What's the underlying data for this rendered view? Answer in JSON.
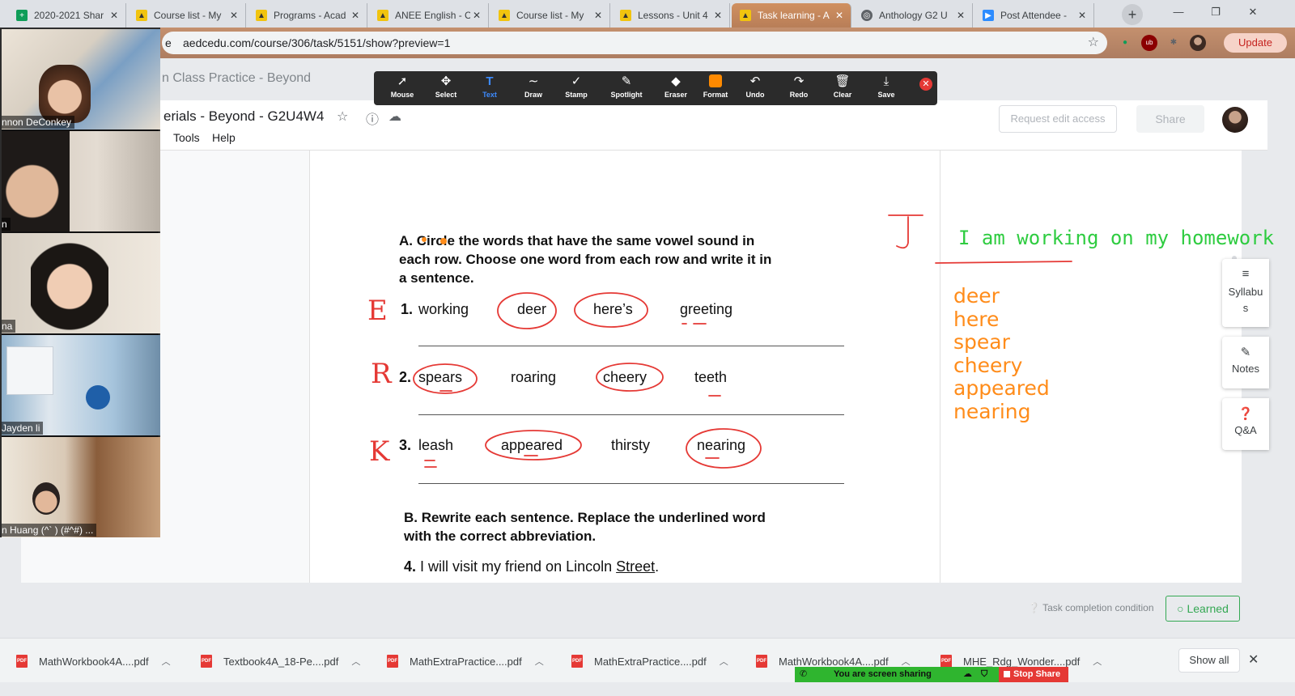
{
  "tabs": [
    {
      "title": "2020-2021 Shar",
      "icon": "sheets-icon",
      "color": "#0f9d58"
    },
    {
      "title": "Course list - My",
      "icon": "course-icon",
      "color": "#f1c40f"
    },
    {
      "title": "Programs - Acad",
      "icon": "course-icon",
      "color": "#f1c40f"
    },
    {
      "title": "ANEE English - C",
      "icon": "course-icon",
      "color": "#f1c40f"
    },
    {
      "title": "Course list - My",
      "icon": "course-icon",
      "color": "#f1c40f"
    },
    {
      "title": "Lessons - Unit 4",
      "icon": "course-icon",
      "color": "#f1c40f"
    },
    {
      "title": "Task learning - A",
      "icon": "course-icon",
      "color": "#f1c40f",
      "active": true
    },
    {
      "title": "Anthology G2 U",
      "icon": "globe-icon",
      "color": "#5f6368"
    },
    {
      "title": "Post Attendee -",
      "icon": "zoom-icon",
      "color": "#2d8cff"
    }
  ],
  "address": {
    "url": "aedcedu.com/course/306/task/5151/show?preview=1",
    "prefix": "e",
    "update_label": "Update"
  },
  "page": {
    "title": "n Class Practice - Beyond"
  },
  "doc": {
    "name": "erials - Beyond - G2U4W4",
    "menu": [
      "Tools",
      "Help"
    ],
    "request_label": "Request edit access",
    "share_label": "Share"
  },
  "worksheet": {
    "section_a": [
      "A. Circle the words that have the same vowel sound in",
      "each row. Choose one word from each row and write it in",
      "a sentence."
    ],
    "rows": [
      {
        "num": "1.",
        "words": [
          "working",
          "deer",
          "here’s",
          "greeting"
        ]
      },
      {
        "num": "2.",
        "words": [
          "spears",
          "roaring",
          "cheery",
          "teeth"
        ]
      },
      {
        "num": "3.",
        "words": [
          "leash",
          "appeared",
          "thirsty",
          "nearing"
        ]
      }
    ],
    "section_b": [
      "B. Rewrite each sentence. Replace the underlined word",
      "with the correct abbreviation."
    ],
    "sentence4": {
      "num": "4.",
      "before": "I will visit my friend on Lincoln ",
      "underlined": "Street",
      "after": "."
    }
  },
  "annotations": {
    "row_letters": [
      "E",
      "R",
      "K"
    ],
    "green_text": "I am working on my homework",
    "orange_words": [
      "deer",
      "here",
      "spear",
      "cheery",
      "appeared",
      "nearing"
    ],
    "corner_letter": "J",
    "colors": {
      "red": "#e53935",
      "green": "#2ecc40",
      "orange": "#ff8c1a"
    }
  },
  "sidepanel": [
    {
      "label": "Syllabus",
      "icon": "menu-icon"
    },
    {
      "label": "Notes",
      "icon": "pencil-icon"
    },
    {
      "label": "Q&A",
      "icon": "question-icon"
    }
  ],
  "footer": {
    "task_condition": "Task completion condition",
    "learned_label": "Learned"
  },
  "toolbar": [
    {
      "label": "Mouse",
      "icon": "cursor-icon"
    },
    {
      "label": "Select",
      "icon": "move-icon"
    },
    {
      "label": "Text",
      "icon": "text-icon",
      "active": true
    },
    {
      "label": "Draw",
      "icon": "draw-icon"
    },
    {
      "label": "Stamp",
      "icon": "stamp-icon"
    },
    {
      "label": "Spotlight",
      "icon": "spotlight-icon"
    },
    {
      "label": "Eraser",
      "icon": "eraser-icon"
    },
    {
      "label": "Format",
      "icon": "format-icon"
    },
    {
      "label": "Undo",
      "icon": "undo-icon"
    },
    {
      "label": "Redo",
      "icon": "redo-icon"
    },
    {
      "label": "Clear",
      "icon": "trash-icon"
    },
    {
      "label": "Save",
      "icon": "save-icon"
    }
  ],
  "participants": [
    {
      "name": "nnon DeConkey"
    },
    {
      "name": "n"
    },
    {
      "name": "na"
    },
    {
      "name": "Jayden li"
    },
    {
      "name": "n Huang (^` ) (#^#) ..."
    }
  ],
  "downloads": [
    "MathWorkbook4A....pdf",
    "Textbook4A_18-Pe....pdf",
    "MathExtraPractice....pdf",
    "MathExtraPractice....pdf",
    "MathWorkbook4A....pdf",
    "MHE_Rdg_Wonder....pdf"
  ],
  "downloads_show_all": "Show all",
  "screen_share": {
    "status": "You are screen sharing",
    "stop_label": "Stop Share"
  }
}
